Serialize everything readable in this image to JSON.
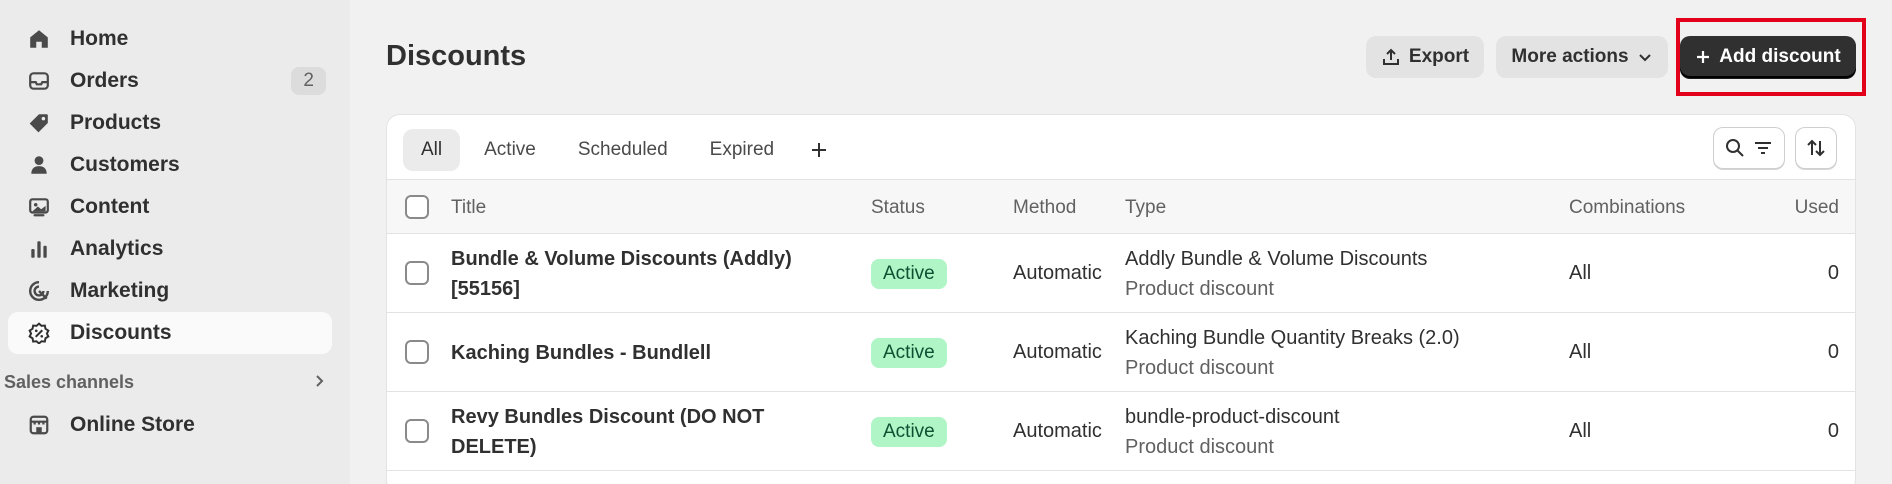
{
  "sidebar": {
    "items": [
      {
        "label": "Home",
        "icon": "home-icon"
      },
      {
        "label": "Orders",
        "icon": "orders-icon",
        "badge": "2"
      },
      {
        "label": "Products",
        "icon": "tag-icon"
      },
      {
        "label": "Customers",
        "icon": "person-icon"
      },
      {
        "label": "Content",
        "icon": "image-icon"
      },
      {
        "label": "Analytics",
        "icon": "bar-chart-icon"
      },
      {
        "label": "Marketing",
        "icon": "target-icon"
      },
      {
        "label": "Discounts",
        "icon": "discount-badge-icon",
        "active": true
      }
    ],
    "sales_channels_label": "Sales channels",
    "online_store_label": "Online Store"
  },
  "header": {
    "title": "Discounts",
    "export_label": "Export",
    "more_actions_label": "More actions",
    "add_discount_label": "Add discount"
  },
  "tabs": [
    "All",
    "Active",
    "Scheduled",
    "Expired"
  ],
  "table": {
    "columns": {
      "title": "Title",
      "status": "Status",
      "method": "Method",
      "type": "Type",
      "combinations": "Combinations",
      "used": "Used"
    },
    "rows": [
      {
        "title_line1": "Bundle & Volume Discounts (Addly)",
        "title_line2": "[55156]",
        "status": "Active",
        "method": "Automatic",
        "type": "Addly Bundle & Volume Discounts",
        "type_sub": "Product discount",
        "combinations": "All",
        "used": "0"
      },
      {
        "title_line1": "Kaching Bundles - Bundlell",
        "title_line2": "",
        "status": "Active",
        "method": "Automatic",
        "type": "Kaching Bundle Quantity Breaks (2.0)",
        "type_sub": "Product discount",
        "combinations": "All",
        "used": "0"
      },
      {
        "title_line1": "Revy Bundles Discount (DO NOT",
        "title_line2": "DELETE)",
        "status": "Active",
        "method": "Automatic",
        "type": "bundle-product-discount",
        "type_sub": "Product discount",
        "combinations": "All",
        "used": "0"
      }
    ]
  },
  "colors": {
    "active_pill_bg": "#aff5c6",
    "active_pill_text": "#0c5132",
    "primary_button": "#303030",
    "highlight": "#e3001b"
  }
}
